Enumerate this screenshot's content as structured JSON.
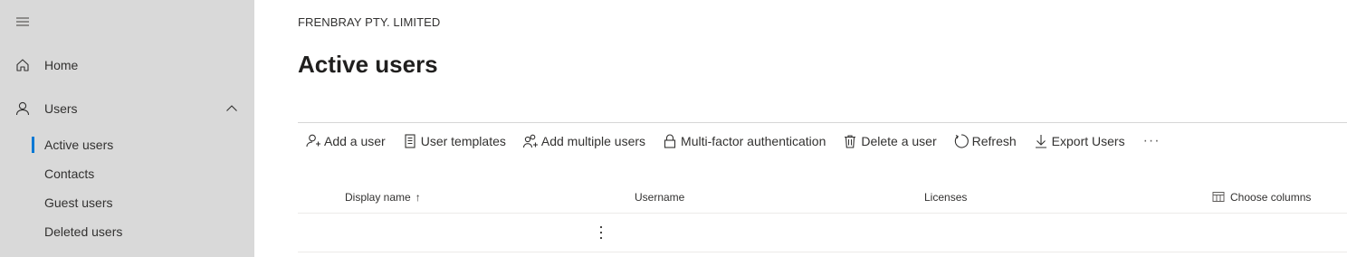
{
  "sidebar": {
    "menu_icon": "hamburger-icon",
    "items": [
      {
        "label": "Home",
        "icon": "home-icon"
      },
      {
        "label": "Users",
        "icon": "person-icon",
        "expanded": true
      }
    ],
    "sub_items": [
      {
        "label": "Active users",
        "active": true
      },
      {
        "label": "Contacts",
        "active": false
      },
      {
        "label": "Guest users",
        "active": false
      },
      {
        "label": "Deleted users",
        "active": false
      }
    ]
  },
  "header": {
    "org_name": "FRENBRAY PTY. LIMITED",
    "page_title": "Active users"
  },
  "toolbar": {
    "buttons": [
      {
        "label": "Add a user",
        "icon": "add-person-icon"
      },
      {
        "label": "User templates",
        "icon": "template-icon"
      },
      {
        "label": "Add multiple users",
        "icon": "add-people-icon"
      },
      {
        "label": "Multi-factor authentication",
        "icon": "lock-icon"
      },
      {
        "label": "Delete a user",
        "icon": "trash-icon"
      },
      {
        "label": "Refresh",
        "icon": "refresh-icon"
      },
      {
        "label": "Export Users",
        "icon": "download-icon"
      }
    ],
    "more": "···"
  },
  "table": {
    "columns": [
      "Display name",
      "Username",
      "Licenses"
    ],
    "sort_indicator": "↑",
    "choose_columns": "Choose columns"
  },
  "colors": {
    "sidebar_bg": "#d9d9d9",
    "accent": "#0078d4",
    "text": "#323130"
  }
}
